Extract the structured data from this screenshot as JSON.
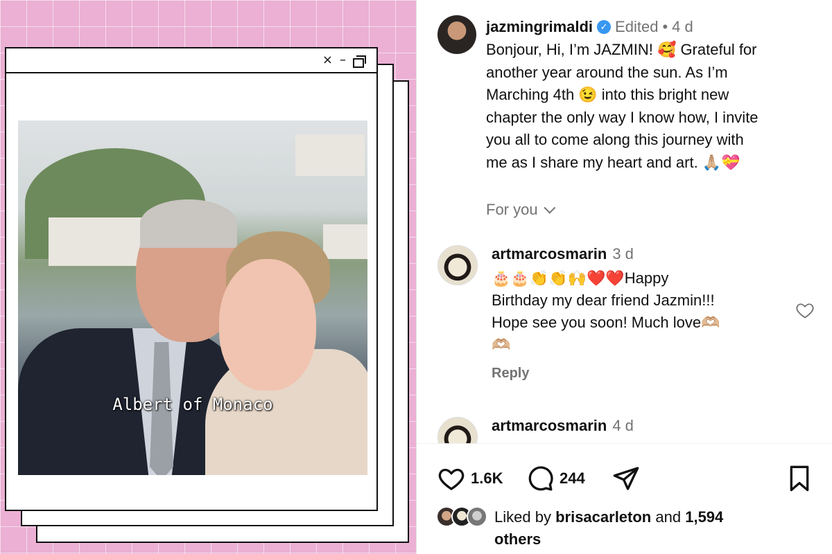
{
  "media": {
    "caption": "Albert of Monaco",
    "window_controls": {
      "close": "×",
      "minimize": "–"
    }
  },
  "post": {
    "author": "jazmingrimaldi",
    "edited_label": "Edited",
    "separator": "•",
    "time": "4 d",
    "caption_lines": [
      "Bonjour, Hi, I’m JAZMIN! 🥰 Grateful for",
      "another year around the sun. As I’m",
      "Marching 4th 😉 into this bright new",
      "chapter the only way I know how, I invite",
      "you all to come along this journey with",
      "me as I share my heart and art. 🙏🏼💝"
    ],
    "for_you": "For you"
  },
  "comments": [
    {
      "username": "artmarcosmarin",
      "time": "3 d",
      "lines": [
        "🎂🎂👏👏🙌❤️❤️Happy",
        "Birthday my dear friend Jazmin!!!",
        "Hope see you soon! Much love🫶🏼",
        "🫶🏼"
      ],
      "reply_label": "Reply"
    },
    {
      "username": "artmarcosmarin",
      "time": "4 d"
    }
  ],
  "actions": {
    "likes_count": "1.6K",
    "comments_count": "244"
  },
  "liked_by": {
    "prefix": "Liked by",
    "user": "brisacarleton",
    "and": "and",
    "others": "1,594",
    "suffix": "others"
  },
  "colors": {
    "pink_background": "#ebb0d4",
    "verified_blue": "#3897f0",
    "muted_text": "#737373"
  }
}
